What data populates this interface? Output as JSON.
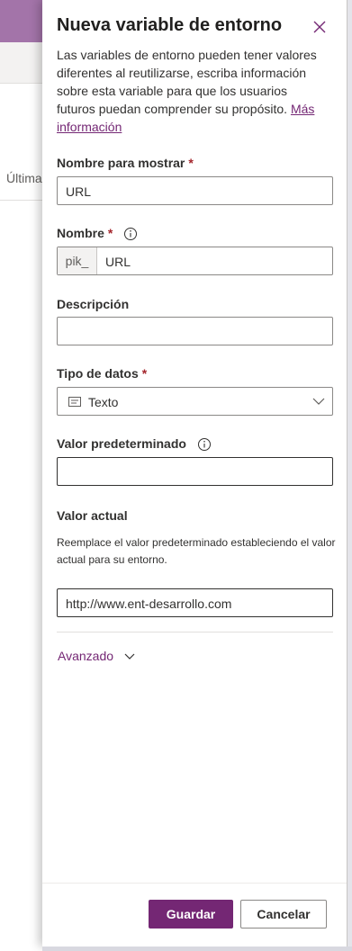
{
  "background": {
    "column_header": "Última"
  },
  "panel": {
    "title": "Nueva variable de entorno",
    "description": "Las variables de entorno pueden tener valores diferentes al reutilizarse, escriba información sobre esta variable para que los usuarios futuros puedan comprender su propósito.",
    "more_info_link": "Más información"
  },
  "fields": {
    "display_name": {
      "label": "Nombre para mostrar",
      "required": "*",
      "value": "URL"
    },
    "name": {
      "label": "Nombre",
      "required": "*",
      "prefix": "pik_",
      "value": "URL"
    },
    "description": {
      "label": "Descripción",
      "value": ""
    },
    "data_type": {
      "label": "Tipo de datos",
      "required": "*",
      "value": "Texto"
    },
    "default_value": {
      "label": "Valor predeterminado",
      "value": ""
    },
    "current_value": {
      "label": "Valor actual",
      "help": "Reemplace el valor predeterminado estableciendo el valor actual para su entorno.",
      "value": "http://www.ent-desarrollo.com"
    }
  },
  "advanced": {
    "label": "Avanzado"
  },
  "footer": {
    "save": "Guardar",
    "cancel": "Cancelar"
  },
  "colors": {
    "accent": "#742774",
    "required": "#a4262c",
    "header_bg": "#a374a9"
  },
  "icons": [
    "close-icon",
    "info-icon",
    "text-type-icon",
    "chevron-down-icon"
  ]
}
